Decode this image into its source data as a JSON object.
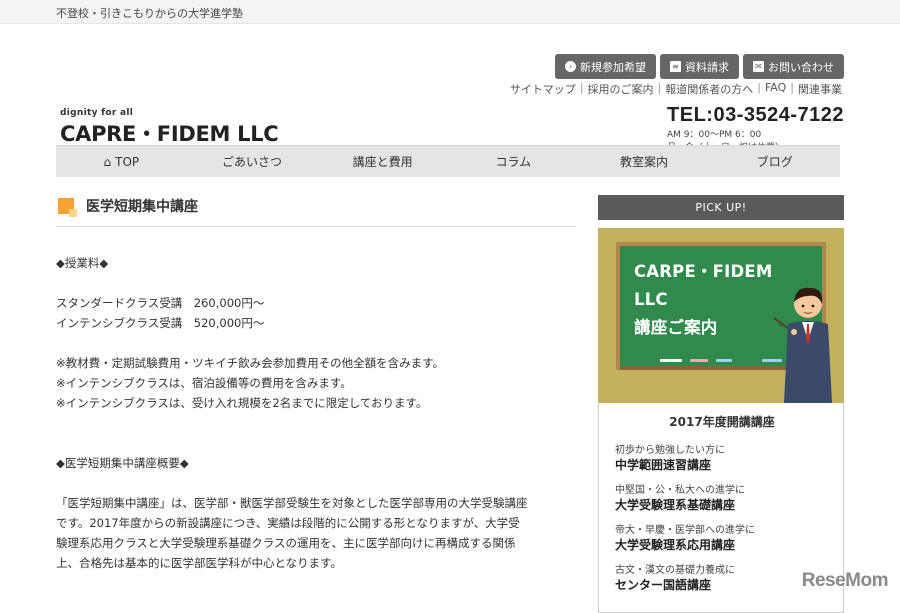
{
  "topbar": {
    "tagline": "不登校・引きこもりからの大学進学塾"
  },
  "header": {
    "buttons": [
      {
        "label": "新規参加希望",
        "icon": "arrow-right-circle-icon"
      },
      {
        "label": "資料請求",
        "icon": "document-icon"
      },
      {
        "label": "お問い合わせ",
        "icon": "mail-icon"
      }
    ],
    "links": [
      "サイトマップ",
      "採用のご案内",
      "報道関係者の方へ",
      "FAQ",
      "関連事業"
    ],
    "logo_tag": "dignity for all",
    "logo_name": "CAPRE・FIDEM LLC",
    "tel": "TEL:03-3524-7122",
    "hours1": "AM 9：00～PM 6：00",
    "hours2": "月～金（土・日・祝は休業）"
  },
  "nav": {
    "items": [
      "TOP",
      "ごあいさつ",
      "講座と費用",
      "コラム",
      "教室案内",
      "ブログ"
    ]
  },
  "main": {
    "title": "医学短期集中講座",
    "fee_heading": "◆授業料◆",
    "fee_standard": "スタンダードクラス受講　260,000円～",
    "fee_intensive": "インテンシブクラス受講　520,000円～",
    "note1": "※教材費・定期試験費用・ツキイチ飲み会参加費用その他全額を含みます。",
    "note2": "※インテンシブクラスは、宿泊設備等の費用を含みます。",
    "note3": "※インテンシブクラスは、受け入れ規模を2名までに限定しております。",
    "overview_heading": "◆医学短期集中講座概要◆",
    "overview_1": "「医学短期集中講座」は、医学部・獣医学部受験生を対象とした医学部専用の大学受験講座",
    "overview_2": "です。2017年度からの新設講座につき、実績は段階的に公開する形となりますが、大学受",
    "overview_3": "験理系応用クラスと大学受験理系基礎クラスの運用を、主に医学部向けに再構成する関係",
    "overview_4": "上、合格先は基本的に医学部医学科が中心となります。"
  },
  "sidebar": {
    "pickup": "PICK UP!",
    "banner_line1": "CARPE・FIDEM",
    "banner_line2": "LLC",
    "banner_line3": "講座ご案内",
    "courses_title": "2017年度開講講座",
    "courses": [
      {
        "sub": "初歩から勉強したい方に",
        "title": "中学範囲速習講座"
      },
      {
        "sub": "中堅国・公・私大への進学に",
        "title": "大学受験理系基礎講座"
      },
      {
        "sub": "帝大・早慶・医学部への進学に",
        "title": "大学受験理系応用講座"
      },
      {
        "sub": "古文・漢文の基礎力養成に",
        "title": "センター国語講座"
      }
    ]
  },
  "watermark": "ReseMom"
}
